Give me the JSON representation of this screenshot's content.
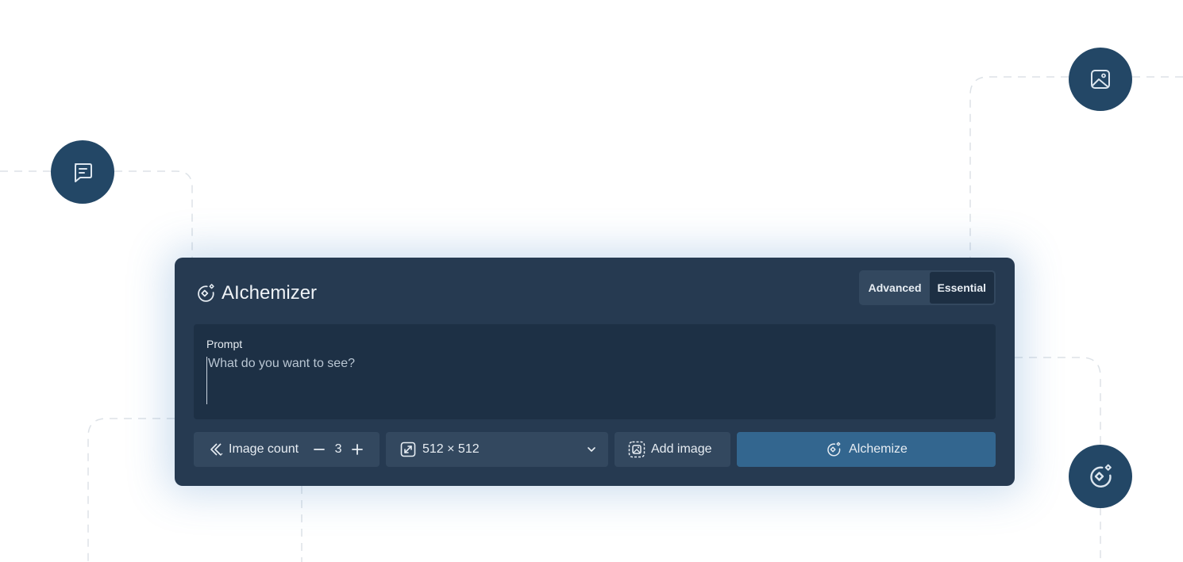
{
  "panel": {
    "title": "AIchemizer",
    "icon": "sparkle-target-icon"
  },
  "mode_toggle": {
    "options": [
      "Advanced",
      "Essential"
    ],
    "selected": "Essential"
  },
  "prompt": {
    "label": "Prompt",
    "placeholder": "What do you want to see?",
    "value": ""
  },
  "controls": {
    "image_count": {
      "label": "Image count",
      "value": "3",
      "decrement_icon": "minus-icon",
      "increment_icon": "plus-icon"
    },
    "size": {
      "value": "512 × 512",
      "icon": "resize-icon",
      "dropdown_icon": "chevron-down-icon"
    },
    "add_image": {
      "label": "Add image",
      "icon": "image-placeholder-icon"
    },
    "alchemize": {
      "label": "Alchemize",
      "icon": "sparkle-target-icon"
    }
  },
  "floating_icons": [
    "chat-icon",
    "image-icon",
    "sparkle-target-icon"
  ],
  "colors": {
    "panel_bg": "#263a51",
    "prompt_bg": "#1d3045",
    "control_bg": "#33485f",
    "primary_button": "#33668f",
    "circle_bg": "#234766",
    "text": "#e7edf3"
  }
}
